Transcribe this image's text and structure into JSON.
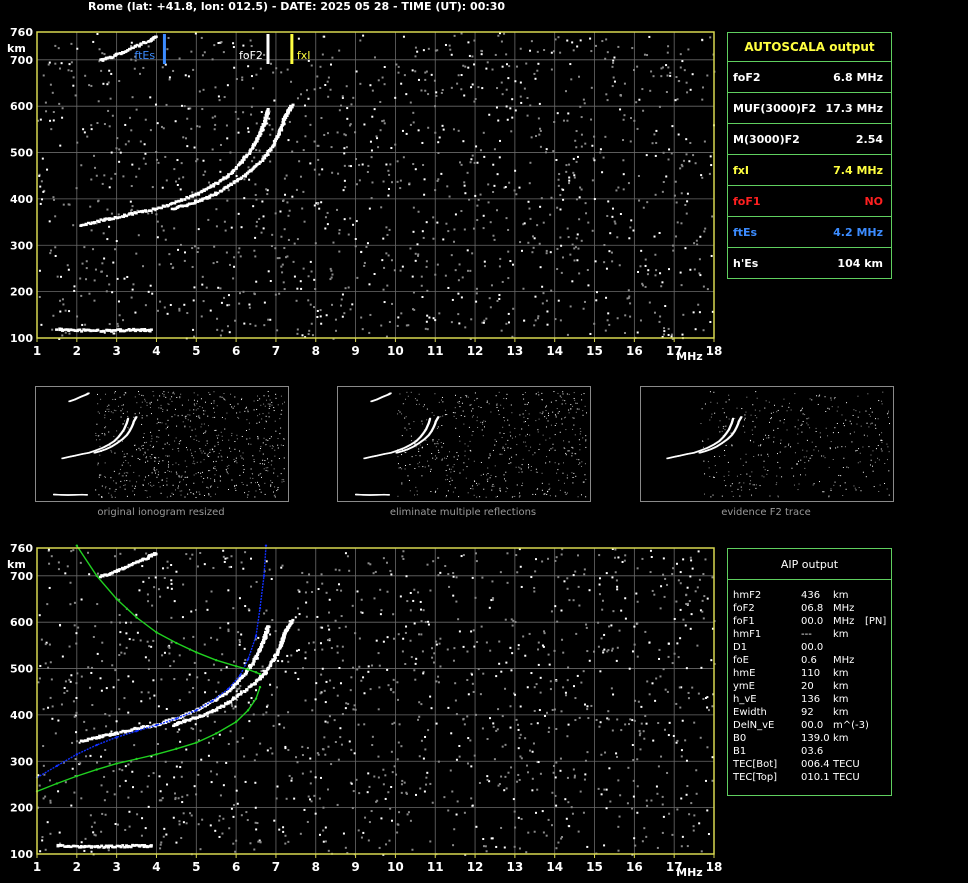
{
  "header": "Rome (lat: +41.8, lon: 012.5) - DATE: 2025 05 28 - TIME (UT): 00:30",
  "autoscala": {
    "title": "AUTOSCALA output",
    "rows": [
      {
        "key": "foF2",
        "value": "6.8 MHz",
        "color": "#ffffff"
      },
      {
        "key": "MUF(3000)F2",
        "value": "17.3 MHz",
        "color": "#ffffff"
      },
      {
        "key": "M(3000)F2",
        "value": "2.54",
        "color": "#ffffff"
      },
      {
        "key": "fxI",
        "value": "7.4 MHz",
        "color": "#ffff40"
      },
      {
        "key": "foF1",
        "value": "NO",
        "color": "#ff2020"
      },
      {
        "key": "ftEs",
        "value": "4.2 MHz",
        "color": "#3c8cff"
      },
      {
        "key": "h'Es",
        "value": "104     km",
        "color": "#ffffff"
      }
    ]
  },
  "aip": {
    "title": "AIP output",
    "rows": [
      {
        "name": "hmF2",
        "value": "436",
        "unit": "km",
        "extra": ""
      },
      {
        "name": "foF2",
        "value": "06.8",
        "unit": "MHz",
        "extra": ""
      },
      {
        "name": "foF1",
        "value": "00.0",
        "unit": "MHz",
        "extra": "[PN]"
      },
      {
        "name": "hmF1",
        "value": "---",
        "unit": "km",
        "extra": ""
      },
      {
        "name": "D1",
        "value": "00.0",
        "unit": "",
        "extra": ""
      },
      {
        "name": "foE",
        "value": "0.6",
        "unit": "MHz",
        "extra": ""
      },
      {
        "name": "hmE",
        "value": "110",
        "unit": "km",
        "extra": ""
      },
      {
        "name": "ymE",
        "value": "20",
        "unit": "km",
        "extra": ""
      },
      {
        "name": "h_vE",
        "value": "136",
        "unit": "km",
        "extra": ""
      },
      {
        "name": "Ewidth",
        "value": "92",
        "unit": "km",
        "extra": ""
      },
      {
        "name": "DelN_vE",
        "value": "00.0",
        "unit": "m^(-3)",
        "extra": ""
      },
      {
        "name": "B0",
        "value": "139.0",
        "unit": "km",
        "extra": ""
      },
      {
        "name": "B1",
        "value": "03.6",
        "unit": "",
        "extra": ""
      },
      {
        "name": "TEC[Bot]",
        "value": "006.4",
        "unit": "TECU",
        "extra": ""
      },
      {
        "name": "TEC[Top]",
        "value": "010.1",
        "unit": "TECU",
        "extra": ""
      }
    ]
  },
  "captions": [
    "original ionogram resized",
    "eliminate multiple reflections",
    "evidence F2 trace"
  ],
  "chart_data": [
    {
      "type": "scatter",
      "title": "",
      "xlabel": "MHz",
      "ylabel": "km",
      "xlim": [
        1,
        18
      ],
      "ylim": [
        100,
        760
      ],
      "xticks": [
        "1",
        "2",
        "3",
        "4",
        "5",
        "6",
        "7",
        "8",
        "9",
        "10",
        "11",
        "12",
        "13",
        "14",
        "15",
        "16",
        "17",
        "18"
      ],
      "yticks": [
        "100",
        "200",
        "300",
        "400",
        "500",
        "600",
        "700",
        "760"
      ],
      "grid": true,
      "markers": [
        {
          "label": "ftEs",
          "x": 4.2,
          "color": "#3c8cff"
        },
        {
          "label": "foF2",
          "x": 6.8,
          "color": "#ffffff"
        },
        {
          "label": "fxI",
          "x": 7.4,
          "color": "#ffff40"
        }
      ],
      "series": [
        {
          "color": "#ffffff",
          "x": [
            2.1,
            2.6,
            3.0,
            3.5,
            4.0,
            4.5,
            5.0,
            5.4,
            5.8,
            6.1,
            6.3,
            6.5,
            6.6,
            6.7,
            6.75,
            6.8
          ],
          "y": [
            345,
            355,
            362,
            372,
            380,
            395,
            412,
            430,
            452,
            478,
            500,
            525,
            545,
            565,
            580,
            595
          ]
        },
        {
          "color": "#ffffff",
          "x": [
            4.4,
            4.8,
            5.2,
            5.6,
            6.0,
            6.4,
            6.7,
            6.9,
            7.05,
            7.15,
            7.2,
            7.3,
            7.4
          ],
          "y": [
            380,
            390,
            402,
            418,
            440,
            465,
            490,
            515,
            540,
            560,
            575,
            590,
            605
          ]
        },
        {
          "color": "#ffffff",
          "x": [
            1.5,
            2.0,
            2.5,
            3.0,
            3.5,
            3.9
          ],
          "y": [
            120,
            118,
            117,
            118,
            119,
            118
          ]
        },
        {
          "color": "#ffffff",
          "x": [
            2.6,
            3.0,
            3.4,
            3.8,
            4.0
          ],
          "y": [
            700,
            712,
            728,
            742,
            752
          ]
        }
      ]
    },
    {
      "type": "scatter",
      "title": "",
      "xlabel": "MHz",
      "ylabel": "km",
      "xlim": [
        1,
        18
      ],
      "ylim": [
        100,
        760
      ],
      "xticks": [
        "1",
        "2",
        "3",
        "4",
        "5",
        "6",
        "7",
        "8",
        "9",
        "10",
        "11",
        "12",
        "13",
        "14",
        "15",
        "16",
        "17",
        "18"
      ],
      "yticks": [
        "100",
        "200",
        "300",
        "400",
        "500",
        "600",
        "700",
        "760"
      ],
      "grid": true,
      "markers": [],
      "series": [
        {
          "color": "#ffffff",
          "x": [
            2.1,
            2.6,
            3.0,
            3.5,
            4.0,
            4.5,
            5.0,
            5.4,
            5.8,
            6.1,
            6.3,
            6.5,
            6.6,
            6.7,
            6.75,
            6.8
          ],
          "y": [
            345,
            355,
            362,
            372,
            380,
            395,
            412,
            430,
            452,
            478,
            500,
            525,
            545,
            565,
            580,
            595
          ]
        },
        {
          "color": "#ffffff",
          "x": [
            4.4,
            4.8,
            5.2,
            5.6,
            6.0,
            6.4,
            6.7,
            6.9,
            7.05,
            7.15,
            7.2,
            7.3,
            7.4
          ],
          "y": [
            380,
            390,
            402,
            418,
            440,
            465,
            490,
            515,
            540,
            560,
            575,
            590,
            605
          ]
        },
        {
          "color": "#ffffff",
          "x": [
            1.5,
            2.0,
            2.5,
            3.0,
            3.5,
            3.9
          ],
          "y": [
            120,
            118,
            117,
            118,
            119,
            118
          ]
        },
        {
          "color": "#ffffff",
          "x": [
            2.6,
            3.0,
            3.4,
            3.8,
            4.0
          ],
          "y": [
            700,
            712,
            728,
            742,
            752
          ]
        },
        {
          "color": "#1030ff",
          "x": [
            1.0,
            1.5,
            2.0,
            2.5,
            3.0,
            3.5,
            4.0,
            4.5,
            5.0,
            5.4,
            5.8,
            6.1,
            6.3,
            6.5,
            6.6,
            6.7,
            6.75
          ],
          "y": [
            265,
            290,
            315,
            335,
            352,
            365,
            378,
            392,
            410,
            430,
            456,
            485,
            520,
            570,
            630,
            700,
            765
          ]
        },
        {
          "color": "#20d020",
          "x": [
            2.0,
            2.5,
            3.0,
            3.5,
            4.0,
            4.5,
            5.0,
            5.5,
            6.0,
            6.3,
            6.5,
            6.6
          ],
          "y": [
            765,
            700,
            650,
            610,
            578,
            555,
            535,
            518,
            505,
            498,
            492,
            488
          ]
        },
        {
          "color": "#20d020",
          "x": [
            1.0,
            1.5,
            2.0,
            2.5,
            3.0,
            3.5,
            4.0,
            4.5,
            5.0,
            5.5,
            6.0,
            6.3,
            6.5,
            6.6
          ],
          "y": [
            235,
            252,
            268,
            282,
            295,
            305,
            315,
            327,
            340,
            360,
            385,
            410,
            435,
            460
          ]
        }
      ]
    }
  ]
}
